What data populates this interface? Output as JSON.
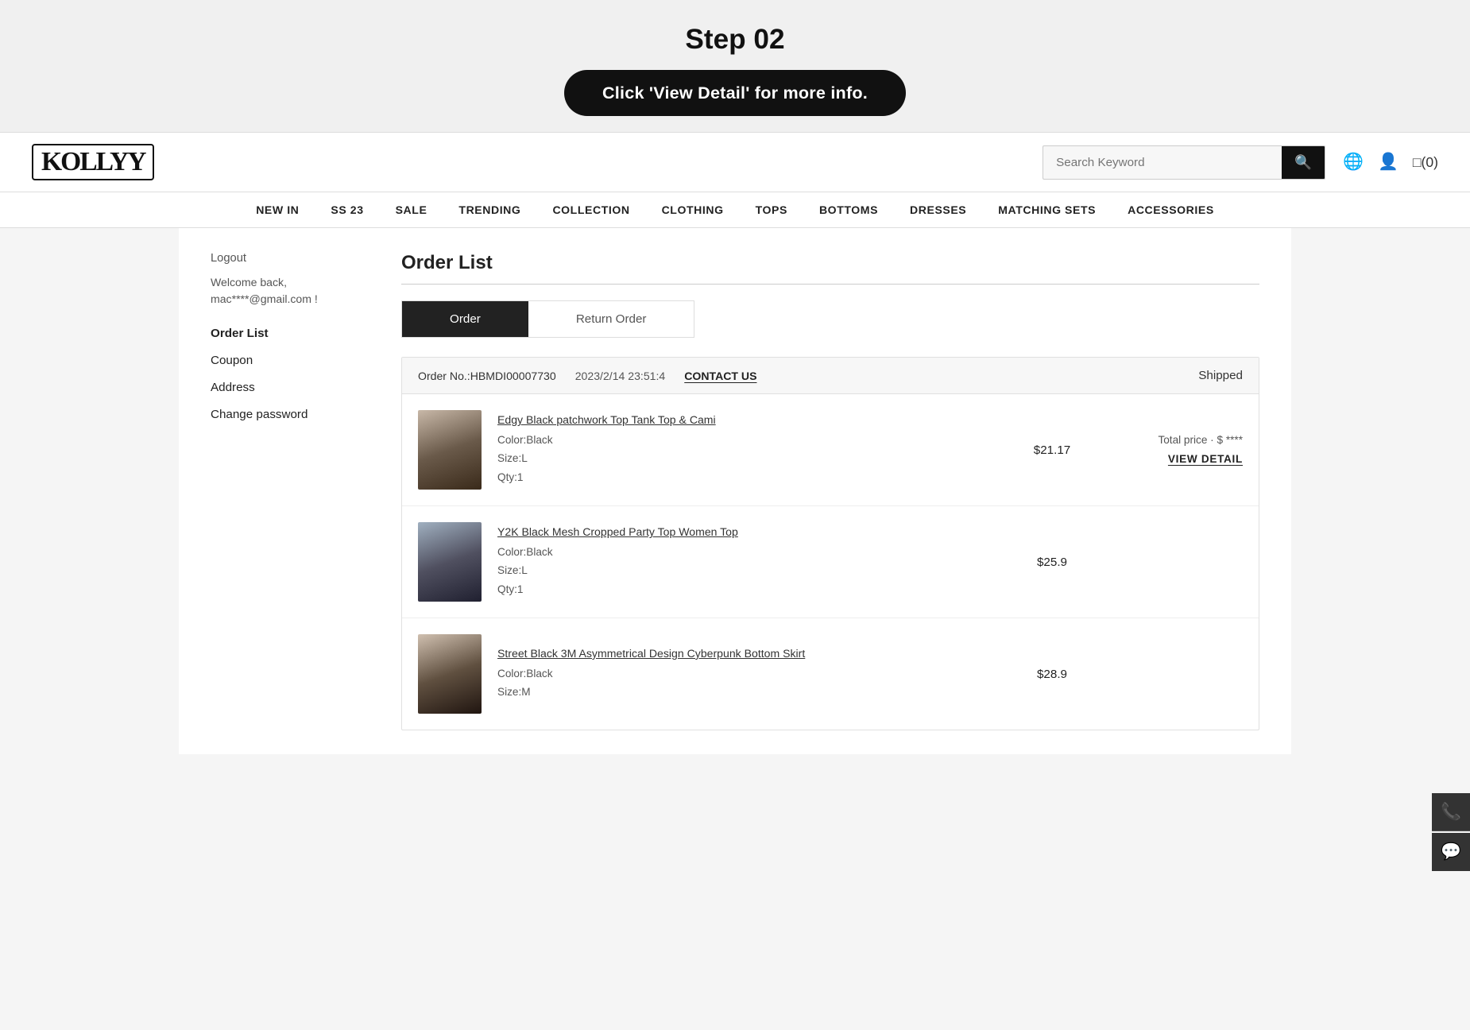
{
  "instruction": {
    "step": "Step 02",
    "pill": "Click 'View Detail' for more info."
  },
  "header": {
    "logo": "KOLLYY",
    "search": {
      "placeholder": "Search Keyword",
      "button_label": "🔍"
    },
    "icons": {
      "globe": "🌐",
      "user": "👤",
      "cart": "□(0)"
    }
  },
  "nav": {
    "items": [
      {
        "label": "NEW IN",
        "href": "#"
      },
      {
        "label": "SS 23",
        "href": "#"
      },
      {
        "label": "SALE",
        "href": "#"
      },
      {
        "label": "TRENDING",
        "href": "#"
      },
      {
        "label": "COLLECTION",
        "href": "#"
      },
      {
        "label": "CLOTHING",
        "href": "#"
      },
      {
        "label": "TOPS",
        "href": "#"
      },
      {
        "label": "BOTTOMS",
        "href": "#"
      },
      {
        "label": "DRESSES",
        "href": "#"
      },
      {
        "label": "MATCHING SETS",
        "href": "#"
      },
      {
        "label": "ACCESSORIES",
        "href": "#"
      }
    ]
  },
  "sidebar": {
    "logout": "Logout",
    "welcome": "Welcome back,\nmac****@gmail.com !",
    "nav_items": [
      {
        "label": "Order List",
        "active": true
      },
      {
        "label": "Coupon",
        "active": false
      },
      {
        "label": "Address",
        "active": false
      },
      {
        "label": "Change password",
        "active": false
      }
    ]
  },
  "order_list": {
    "title": "Order List",
    "tabs": [
      {
        "label": "Order",
        "active": true
      },
      {
        "label": "Return Order",
        "active": false
      }
    ],
    "orders": [
      {
        "order_no": "Order No.:HBMDI00007730",
        "date": "2023/2/14 23:51:4",
        "contact": "CONTACT US",
        "status": "Shipped",
        "total_label": "Total price · $",
        "total_masked": "****",
        "view_detail": "VIEW DETAIL",
        "items": [
          {
            "name": "Edgy Black patchwork Top Tank Top & Cami",
            "color": "Color:Black",
            "size": "Size:L",
            "qty": "Qty:1",
            "price": "$21.17"
          },
          {
            "name": "Y2K Black Mesh Cropped Party Top Women Top",
            "color": "Color:Black",
            "size": "Size:L",
            "qty": "Qty:1",
            "price": "$25.9"
          },
          {
            "name": "Street Black 3M Asymmetrical Design Cyberpunk Bottom Skirt",
            "color": "Color:Black",
            "size": "Size:M",
            "qty": "",
            "price": "$28.9"
          }
        ]
      }
    ]
  },
  "floating": {
    "phone_icon": "📞",
    "chat_icon": "💬"
  }
}
